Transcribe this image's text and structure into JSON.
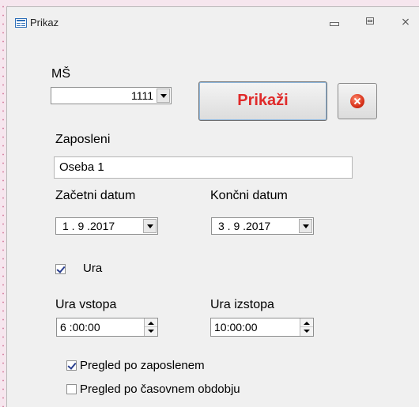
{
  "window": {
    "title": "Prikaz"
  },
  "ms": {
    "label": "MŠ",
    "value": "1111"
  },
  "buttons": {
    "show_label": "Prikaži"
  },
  "employee": {
    "label": "Zaposleni",
    "value": "Oseba 1"
  },
  "dates": {
    "start_label": "Začetni datum",
    "start_value": "1 . 9 .2017",
    "end_label": "Končni datum",
    "end_value": "3 . 9 .2017"
  },
  "hours": {
    "checkbox_label": "Ura",
    "checked": true
  },
  "times": {
    "in_label": "Ura vstopa",
    "in_value": "6 :00:00",
    "out_label": "Ura izstopa",
    "out_value": "10:00:00"
  },
  "options": [
    {
      "label": "Pregled po zaposlenem",
      "checked": true
    },
    {
      "label": "Pregled po časovnem obdobju",
      "checked": false
    }
  ],
  "colors": {
    "accent_red": "#e02a2a",
    "background": "#f0f0f0"
  }
}
